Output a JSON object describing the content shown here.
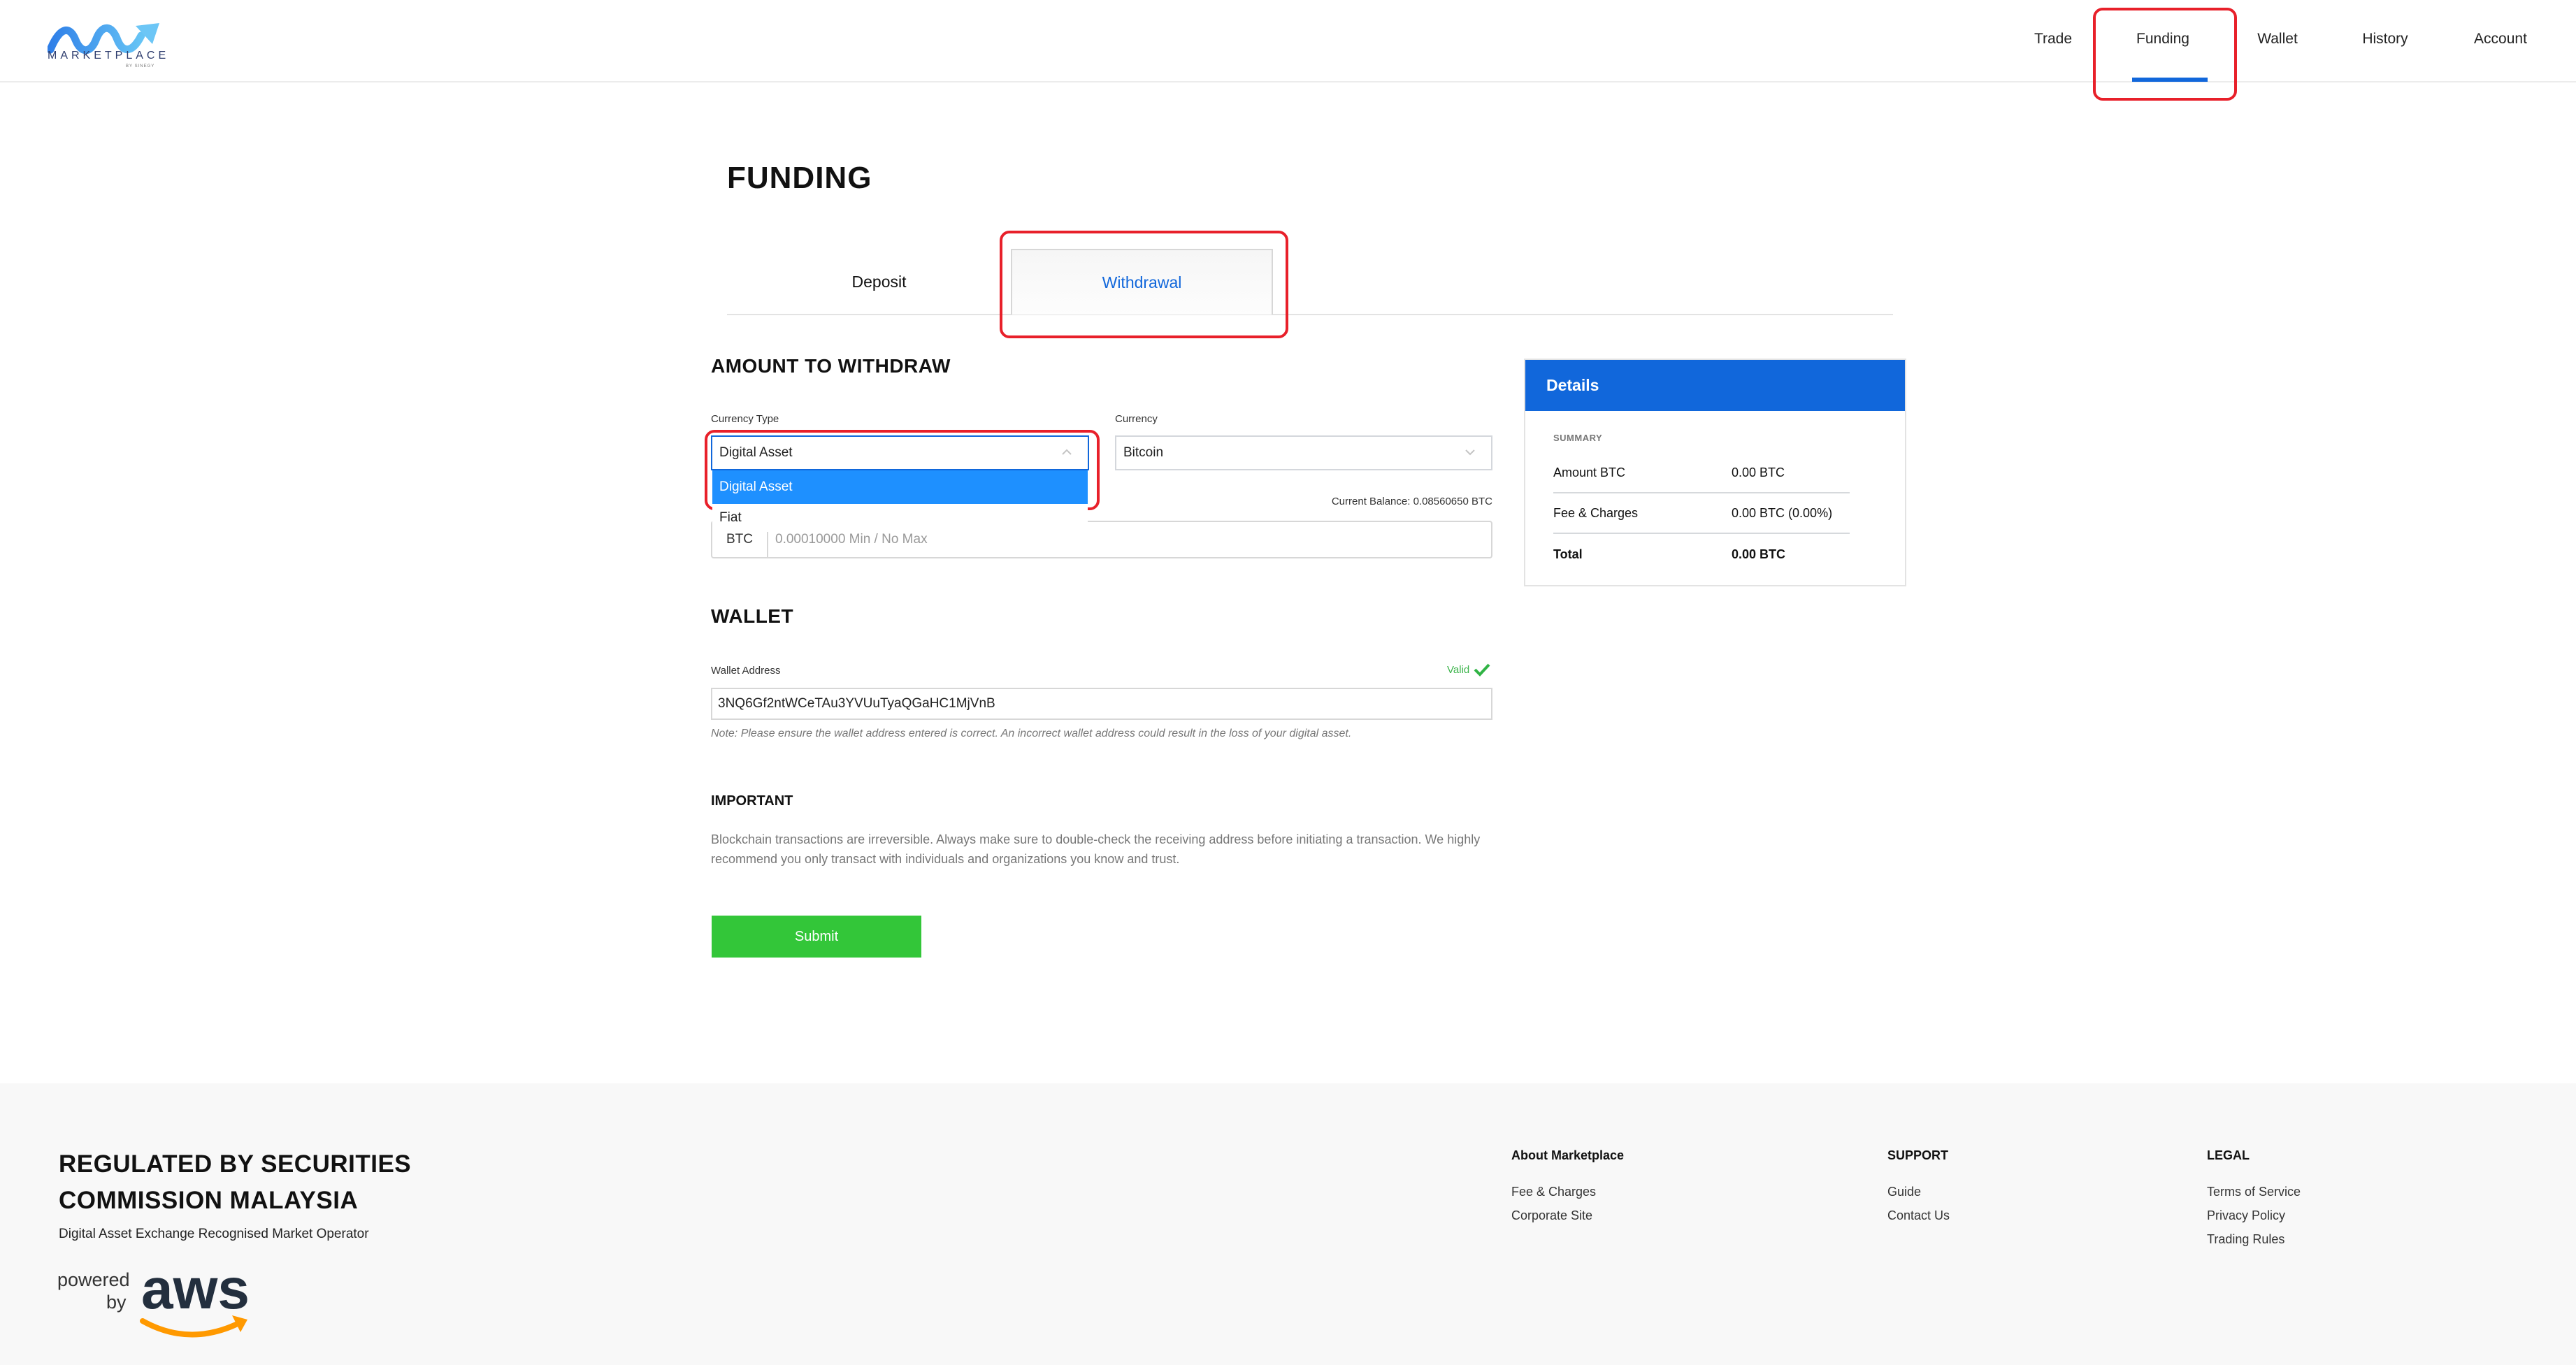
{
  "header": {
    "logo_text": "MARKETPLACE",
    "logo_subtext": "BY SINEGY",
    "nav": [
      {
        "label": "Trade",
        "active": false
      },
      {
        "label": "Funding",
        "active": true
      },
      {
        "label": "Wallet",
        "active": false
      },
      {
        "label": "History",
        "active": false
      },
      {
        "label": "Account",
        "active": false
      }
    ]
  },
  "page": {
    "title": "FUNDING",
    "tabs": [
      {
        "label": "Deposit",
        "active": false
      },
      {
        "label": "Withdrawal",
        "active": true
      }
    ]
  },
  "amount_section": {
    "title": "AMOUNT TO WITHDRAW",
    "currency_type": {
      "label": "Currency Type",
      "value": "Digital Asset",
      "expanded": true,
      "options": [
        {
          "label": "Digital Asset",
          "selected": true
        },
        {
          "label": "Fiat",
          "selected": false
        }
      ]
    },
    "currency": {
      "label": "Currency",
      "value": "Bitcoin"
    },
    "balance_label": "Current Balance:",
    "balance_value": "0.08560650 BTC",
    "amount_prefix": "BTC",
    "amount_placeholder": "0.00010000 Min / No Max",
    "amount_value": ""
  },
  "wallet_section": {
    "title": "WALLET",
    "address_label": "Wallet Address",
    "validity": "Valid",
    "address_value": "3NQ6Gf2ntWCeTAu3YVUuTyaQGaHC1MjVnB",
    "note": "Note: Please ensure the wallet address entered is correct. An incorrect wallet address could result in the loss of your digital asset."
  },
  "important": {
    "title": "IMPORTANT",
    "text": "Blockchain transactions are irreversible. Always make sure to double-check the receiving address before initiating a transaction. We highly recommend you only transact with individuals and organizations you know and trust."
  },
  "submit_label": "Submit",
  "details": {
    "title": "Details",
    "summary_label": "SUMMARY",
    "rows": [
      {
        "label": "Amount BTC",
        "value": "0.00 BTC"
      },
      {
        "label": "Fee & Charges",
        "value": "0.00 BTC (0.00%)"
      },
      {
        "label": "Total",
        "value": "0.00 BTC"
      }
    ]
  },
  "footer": {
    "regulated_line1": "REGULATED BY SECURITIES",
    "regulated_line2": "COMMISSION MALAYSIA",
    "regulated_sub": "Digital Asset Exchange Recognised Market Operator",
    "powered_by": "powered by",
    "aws": "aws",
    "columns": [
      {
        "title": "About Marketplace",
        "links": [
          "Fee & Charges",
          "Corporate Site"
        ]
      },
      {
        "title": "SUPPORT",
        "links": [
          "Guide",
          "Contact Us"
        ]
      },
      {
        "title": "LEGAL",
        "links": [
          "Terms of Service",
          "Privacy Policy",
          "Trading Rules"
        ]
      }
    ]
  },
  "colors": {
    "brand_blue": "#1167db",
    "dropdown_highlight": "#1e90ff",
    "submit_green": "#33c639",
    "valid_green": "#3cb44b",
    "annotation_red": "#e8202a"
  }
}
